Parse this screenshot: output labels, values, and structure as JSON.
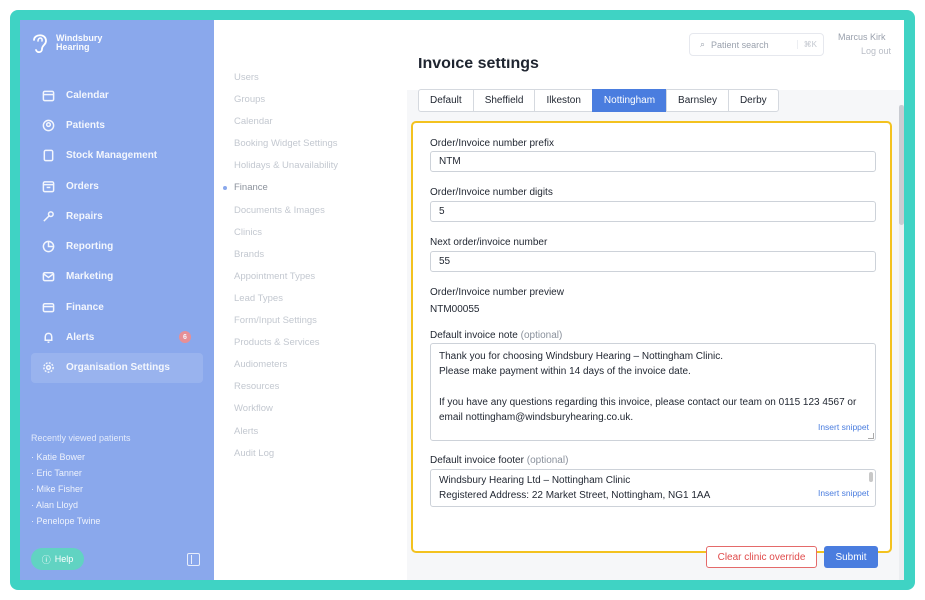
{
  "app": {
    "brand_line1": "Windsbury",
    "brand_line2": "Hearing",
    "brand_color": "#8aa8ec",
    "accent_color": "#4a7ddf",
    "frame_color": "#3fd3c4"
  },
  "sidebar": {
    "items": [
      {
        "label": "Calendar",
        "icon": "calendar-icon"
      },
      {
        "label": "Patients",
        "icon": "patients-icon"
      },
      {
        "label": "Stock Management",
        "icon": "stock-icon"
      },
      {
        "label": "Orders",
        "icon": "orders-icon"
      },
      {
        "label": "Repairs",
        "icon": "wrench-icon"
      },
      {
        "label": "Reporting",
        "icon": "chart-icon"
      },
      {
        "label": "Marketing",
        "icon": "mail-icon"
      },
      {
        "label": "Finance",
        "icon": "card-icon"
      },
      {
        "label": "Alerts",
        "icon": "bell-icon",
        "badge": "6"
      },
      {
        "label": "Organisation Settings",
        "icon": "gear-icon",
        "active": true
      }
    ],
    "recent_title": "Recently viewed patients",
    "recent": [
      "Katie Bower",
      "Eric Tanner",
      "Mike Fisher",
      "Alan Lloyd",
      "Penelope Twine"
    ],
    "help_label": "Help"
  },
  "header": {
    "search_placeholder": "Patient search",
    "search_shortcut": "⌘K",
    "user_name": "Marcus Kirk",
    "logout_label": "Log out"
  },
  "settings_menu": {
    "items": [
      "Users",
      "Groups",
      "Calendar",
      "Booking Widget Settings",
      "Holidays & Unavailability",
      "Finance",
      "Documents & Images",
      "Clinics",
      "Brands",
      "Appointment Types",
      "Lead Types",
      "Form/Input Settings",
      "Products & Services",
      "Audiometers",
      "Resources",
      "Workflow",
      "Alerts",
      "Audit Log"
    ],
    "active": "Finance"
  },
  "page": {
    "title": "Invoice settings",
    "tabs": [
      "Default",
      "Sheffield",
      "Ilkeston",
      "Nottingham",
      "Barnsley",
      "Derby"
    ],
    "active_tab": "Nottingham"
  },
  "form": {
    "prefix_label": "Order/Invoice number prefix",
    "prefix_value": "NTM",
    "digits_label": "Order/Invoice number digits",
    "digits_value": "5",
    "next_label": "Next order/invoice number",
    "next_value": "55",
    "preview_label": "Order/Invoice number preview",
    "preview_value": "NTM00055",
    "note_label": "Default invoice note",
    "optional": "(optional)",
    "note_lines": [
      "Thank you for choosing Windsbury Hearing – Nottingham Clinic.",
      "Please make payment within 14 days of the invoice date.",
      "",
      "If you have any questions regarding this invoice, please contact our team on 0115 123 4567 or",
      "email nottingham@windsburyhearing.co.uk."
    ],
    "footer_label": "Default invoice footer",
    "footer_lines": [
      "Windsbury Hearing Ltd – Nottingham Clinic",
      "Registered Address: 22 Market Street, Nottingham, NG1 1AA"
    ],
    "insert_snippet": "Insert snippet",
    "clear_label": "Clear clinic override",
    "submit_label": "Submit"
  }
}
